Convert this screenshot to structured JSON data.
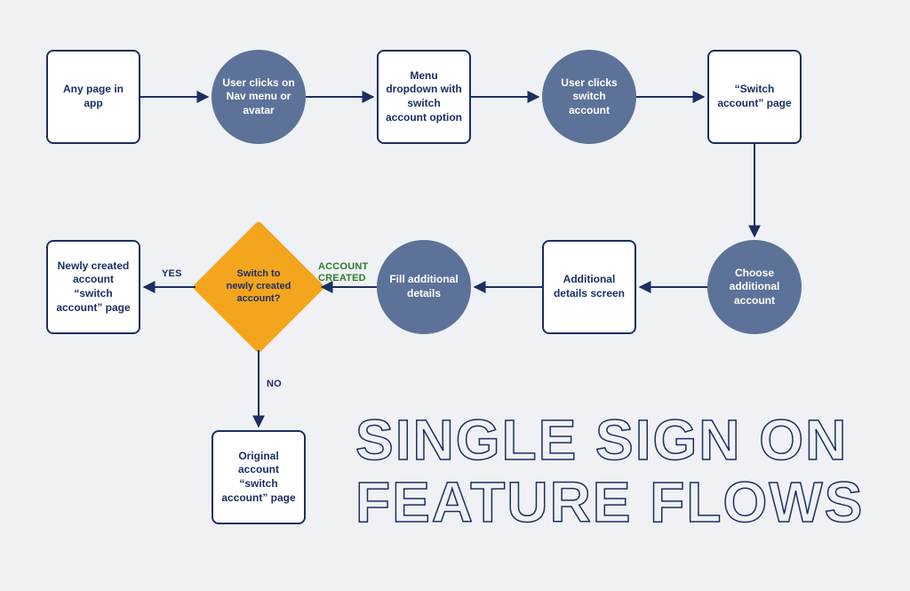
{
  "diagram": {
    "title": "SINGLE SIGN ON FEATURE FLOWS",
    "nodes": {
      "n1": {
        "label": "Any page in app"
      },
      "n2": {
        "label": "User clicks on Nav menu or avatar"
      },
      "n3": {
        "label": "Menu dropdown with switch account option"
      },
      "n4": {
        "label": "User clicks switch account"
      },
      "n5": {
        "label": "“Switch account” page"
      },
      "n6": {
        "label": "Choose additional account"
      },
      "n7": {
        "label": "Additional details screen"
      },
      "n8": {
        "label": "Fill additional details"
      },
      "n9": {
        "label": "Switch to newly created account?"
      },
      "n10": {
        "label": "Newly created account “switch account” page"
      },
      "n11": {
        "label": "Original account “switch account” page"
      }
    },
    "edges": {
      "e9_created": "ACCOUNT CREATED",
      "e9_yes": "YES",
      "e9_no": "NO"
    }
  }
}
